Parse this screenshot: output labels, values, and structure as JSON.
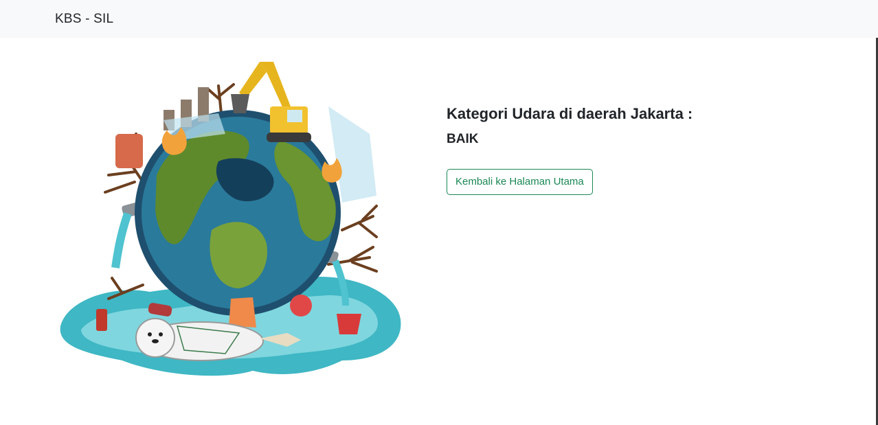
{
  "navbar": {
    "brand": "KBS - SIL"
  },
  "illustration": {
    "subject": "polluted-earth-illustration"
  },
  "result": {
    "heading": "Kategori Udara di daerah Jakarta :",
    "category": "BAIK"
  },
  "actions": {
    "back_label": "Kembali ke Halaman Utama"
  },
  "colors": {
    "navbar_bg": "#f8f9fa",
    "accent": "#198754",
    "text": "#212529"
  }
}
